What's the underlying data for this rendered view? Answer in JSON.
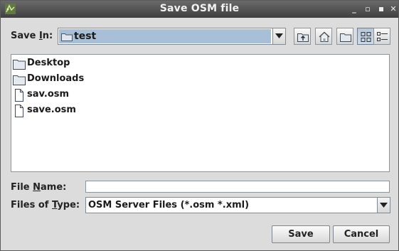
{
  "window": {
    "title": "Save OSM file",
    "controls": {
      "minimize": "_",
      "restore": "▫",
      "close": "✕"
    }
  },
  "save_in": {
    "label": "Save In:",
    "label_prefix": "Save ",
    "label_mnemonic": "I",
    "label_suffix": "n:",
    "current_folder": "test",
    "toolbar_icons": [
      "up-one-level-icon",
      "home-icon",
      "new-folder-icon",
      "list-view-icon",
      "details-view-icon"
    ]
  },
  "files": [
    {
      "name": "Desktop",
      "type": "folder",
      "icon": "folder-icon"
    },
    {
      "name": "Downloads",
      "type": "folder",
      "icon": "folder-icon"
    },
    {
      "name": "sav.osm",
      "type": "file",
      "icon": "file-icon"
    },
    {
      "name": "save.osm",
      "type": "file",
      "icon": "file-icon"
    }
  ],
  "file_name": {
    "label_prefix": "File ",
    "label_mnemonic": "N",
    "label_suffix": "ame:",
    "value": ""
  },
  "file_type": {
    "label_prefix": "Files of ",
    "label_mnemonic": "T",
    "label_suffix": "ype:",
    "selected": "OSM Server Files (*.osm *.xml)"
  },
  "buttons": {
    "save": "Save",
    "cancel": "Cancel"
  }
}
